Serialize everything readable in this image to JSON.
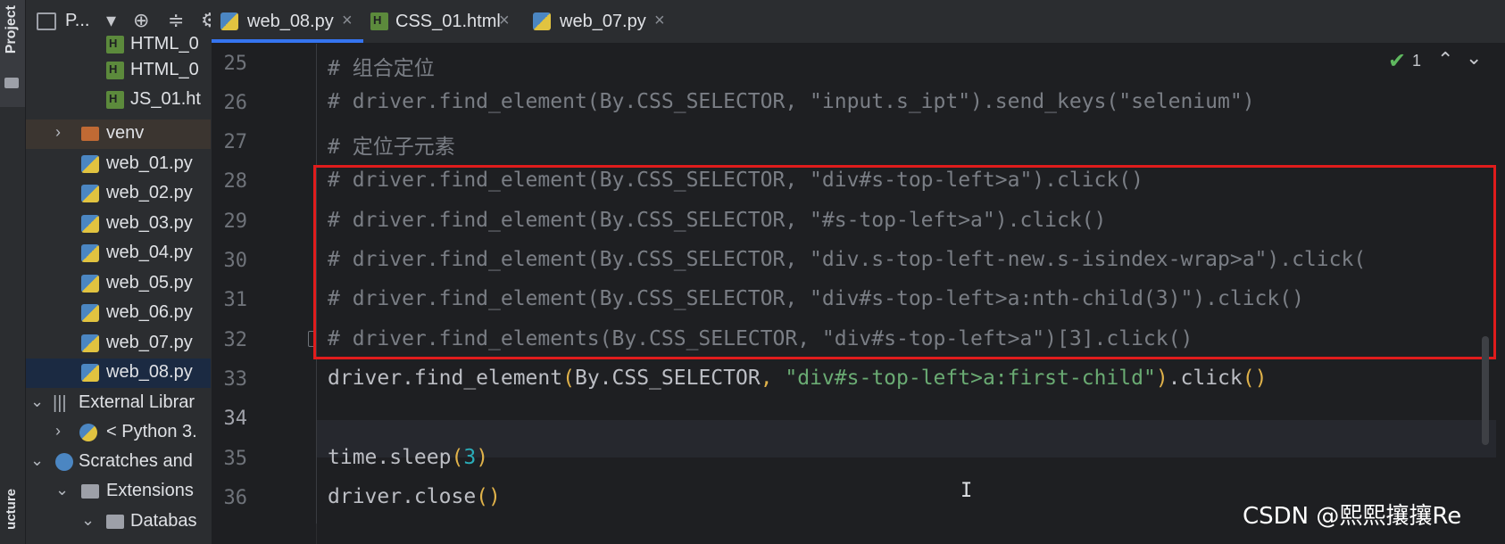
{
  "sidebar": {
    "tool_window_label": "Project",
    "structure_label": "ucture",
    "header_title": "P...",
    "items": [
      {
        "label": "HTML_0",
        "icon": "html-file-icon"
      },
      {
        "label": "HTML_0",
        "icon": "html-file-icon"
      },
      {
        "label": "JS_01.ht",
        "icon": "html-file-icon"
      },
      {
        "label": "venv",
        "icon": "folder-icon"
      },
      {
        "label": "web_01.py",
        "icon": "python-file-icon"
      },
      {
        "label": "web_02.py",
        "icon": "python-file-icon"
      },
      {
        "label": "web_03.py",
        "icon": "python-file-icon"
      },
      {
        "label": "web_04.py",
        "icon": "python-file-icon"
      },
      {
        "label": "web_05.py",
        "icon": "python-file-icon"
      },
      {
        "label": "web_06.py",
        "icon": "python-file-icon"
      },
      {
        "label": "web_07.py",
        "icon": "python-file-icon"
      },
      {
        "label": "web_08.py",
        "icon": "python-file-icon"
      },
      {
        "label": "External Librar",
        "icon": "library-icon"
      },
      {
        "label": "< Python 3.",
        "icon": "python-sdk-icon"
      },
      {
        "label": "Scratches and",
        "icon": "scratches-icon"
      },
      {
        "label": "Extensions",
        "icon": "folder-icon"
      },
      {
        "label": "Databas",
        "icon": "folder-icon"
      }
    ]
  },
  "tabs": [
    {
      "label": "web_08.py",
      "icon": "python-file-icon",
      "active": true
    },
    {
      "label": "CSS_01.html",
      "icon": "html-file-icon",
      "active": false
    },
    {
      "label": "web_07.py",
      "icon": "python-file-icon",
      "active": false
    }
  ],
  "inspection": {
    "count": "1"
  },
  "editor": {
    "lines": [
      {
        "num": "25",
        "text": "# 组合定位"
      },
      {
        "num": "26",
        "text": "# driver.find_element(By.CSS_SELECTOR, \"input.s_ipt\").send_keys(\"selenium\")"
      },
      {
        "num": "27",
        "text": "# 定位子元素"
      },
      {
        "num": "28",
        "text": "# driver.find_element(By.CSS_SELECTOR, \"div#s-top-left>a\").click()"
      },
      {
        "num": "29",
        "text": "# driver.find_element(By.CSS_SELECTOR, \"#s-top-left>a\").click()"
      },
      {
        "num": "30",
        "text": "# driver.find_element(By.CSS_SELECTOR, \"div.s-top-left-new.s-isindex-wrap>a\").click("
      },
      {
        "num": "31",
        "text": "# driver.find_element(By.CSS_SELECTOR, \"div#s-top-left>a:nth-child(3)\").click()"
      },
      {
        "num": "32",
        "text": "# driver.find_elements(By.CSS_SELECTOR, \"div#s-top-left>a\")[3].click()"
      },
      {
        "num": "33",
        "code_a": "driver.find_element",
        "p1": "(",
        "code_b": "By.CSS_SELECTOR",
        "comma": ", ",
        "str": "\"div#s-top-left>a:first-child\"",
        "p2": ")",
        "code_c": ".click",
        "p3": "()"
      },
      {
        "num": "34",
        "text": ""
      },
      {
        "num": "35",
        "code_a": "time.sleep",
        "p1": "(",
        "num_val": "3",
        "p2": ")"
      },
      {
        "num": "36",
        "code_a": "driver.close",
        "p1": "()"
      }
    ]
  },
  "watermark": "CSDN @熙熙攘攘Re"
}
